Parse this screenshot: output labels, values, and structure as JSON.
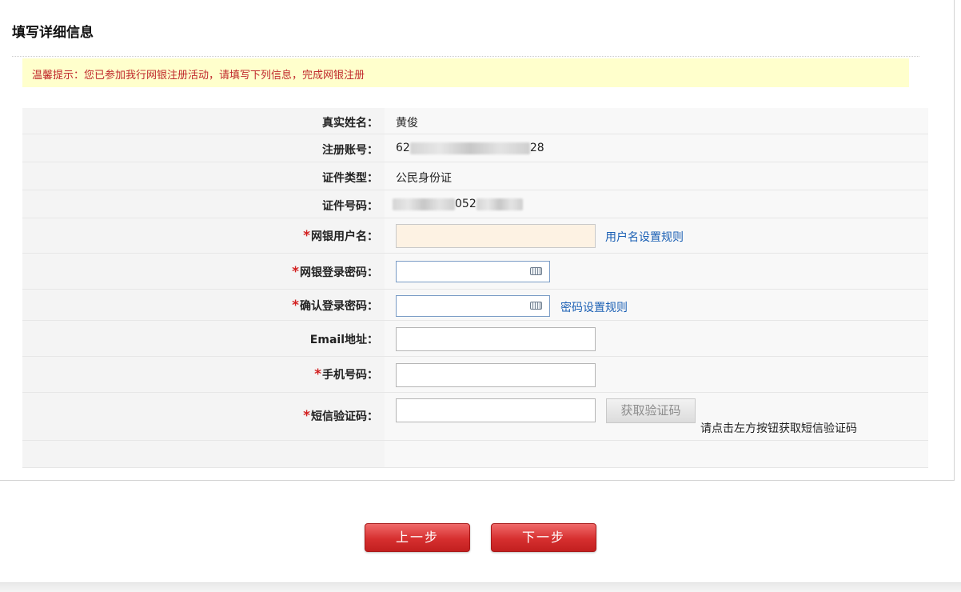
{
  "title": "填写详细信息",
  "notice": "温馨提示：您已参加我行网银注册活动，请填写下列信息，完成网银注册",
  "fields": {
    "real_name": {
      "label": "真实姓名：",
      "value": "黄俊"
    },
    "account": {
      "label": "注册账号：",
      "prefix": "62",
      "suffix": "28"
    },
    "id_type": {
      "label": "证件类型：",
      "value": "公民身份证"
    },
    "id_number": {
      "label": "证件号码：",
      "middle": "052"
    },
    "username": {
      "label": "网银用户名：",
      "value": "",
      "rule_link": "用户名设置规则"
    },
    "login_password": {
      "label": "网银登录密码：",
      "value": ""
    },
    "confirm_password": {
      "label": "确认登录密码：",
      "value": "",
      "rule_link": "密码设置规则"
    },
    "email": {
      "label": "Email地址：",
      "value": ""
    },
    "mobile": {
      "label": "手机号码：",
      "value": ""
    },
    "sms_code": {
      "label": "短信验证码：",
      "value": "",
      "button": "获取验证码",
      "hint": "请点击左方按钮获取短信验证码"
    }
  },
  "required_mark": "*",
  "buttons": {
    "prev": "上一步",
    "next": "下一步"
  },
  "colors": {
    "notice_bg": "#ffffcc",
    "notice_text": "#c0282b",
    "link": "#1a5fb4",
    "button": "#d62f2f"
  }
}
